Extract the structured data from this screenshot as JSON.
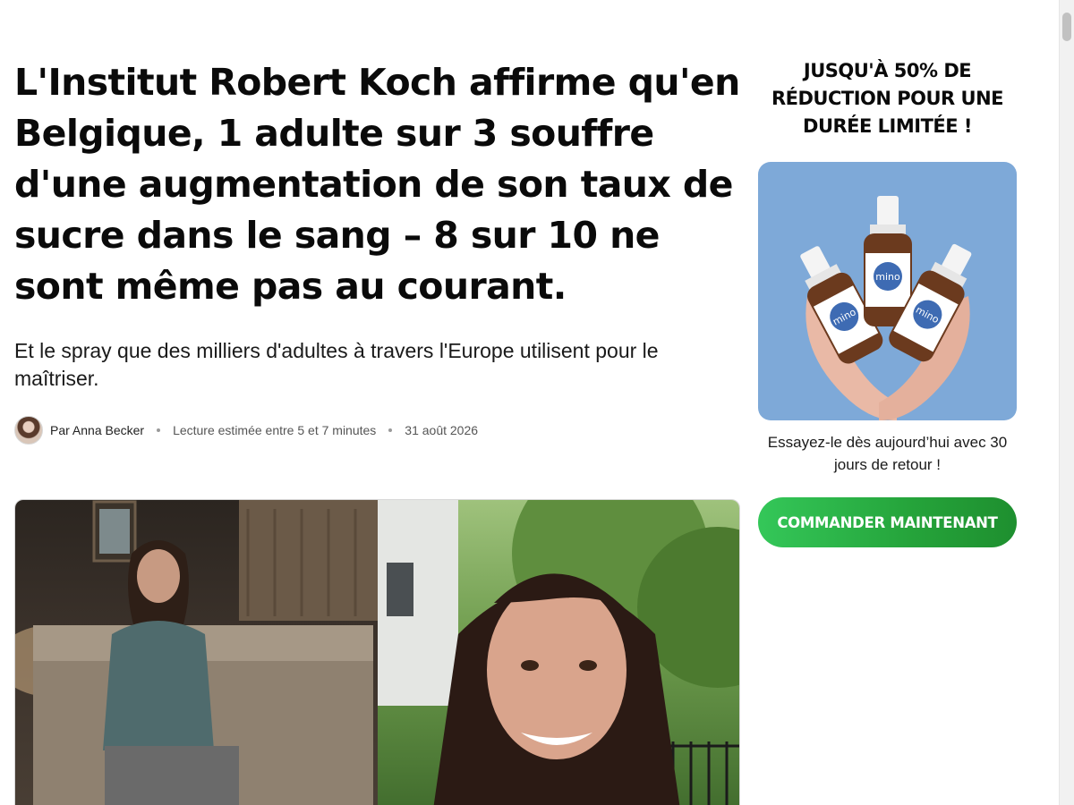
{
  "article": {
    "headline": "L'Institut Robert Koch affirme qu'en Belgique, 1 adulte sur 3 souffre d'une augmentation de son taux de sucre dans le sang – 8 sur 10 ne sont même pas au courant.",
    "subheadline": "Et le spray que des milliers d'adultes à travers l'Europe utilisent pour le maîtriser.",
    "byline": {
      "author": "Par Anna Becker",
      "reading_time": "Lecture estimée entre 5 et 7 minutes",
      "date": "31 août 2026"
    }
  },
  "sidebar": {
    "promo_title": "JUSQU'À 50% DE RÉDUCTION POUR UNE DURÉE LIMITÉE !",
    "promo_note": "Essayez-le dès aujourd’hui avec 30 jours de retour !",
    "cta_label": "COMMANDER MAINTENANT",
    "product_brand": "mi no"
  },
  "colors": {
    "cta_green": "#2bb44a",
    "product_background": "#7ea9d8"
  }
}
